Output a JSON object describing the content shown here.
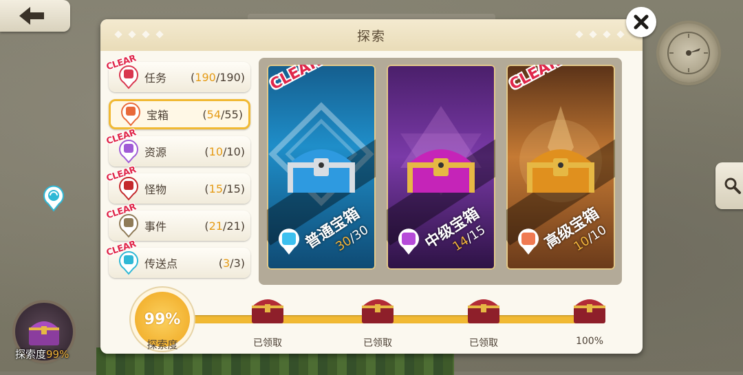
{
  "panel": {
    "title": "探索"
  },
  "categories": [
    {
      "label": "任务",
      "done": "190",
      "total": "190",
      "clear": "CLEAR",
      "color": "#d9364f"
    },
    {
      "label": "宝箱",
      "done": "54",
      "total": "55",
      "clear": "",
      "color": "#e8693a"
    },
    {
      "label": "资源",
      "done": "10",
      "total": "10",
      "clear": "CLEAR",
      "color": "#a05bd6"
    },
    {
      "label": "怪物",
      "done": "15",
      "total": "15",
      "clear": "CLEAR",
      "color": "#c4282c"
    },
    {
      "label": "事件",
      "done": "21",
      "total": "21",
      "clear": "CLEAR",
      "color": "#8f7b58"
    },
    {
      "label": "传送点",
      "done": "3",
      "total": "3",
      "clear": "CLEAR",
      "color": "#2fb8d6"
    }
  ],
  "chests": [
    {
      "name": "普通宝箱",
      "done": "30",
      "total": "/30",
      "clear": "CLEAR",
      "body": "#2e9ae0",
      "trim": "#d8dde3",
      "badge": "#3cc0ef"
    },
    {
      "name": "中级宝箱",
      "done": "14",
      "total": "/15",
      "clear": "",
      "body": "#c524b8",
      "trim": "#e6b844",
      "badge": "#b64bd9"
    },
    {
      "name": "高级宝箱",
      "done": "10",
      "total": "/10",
      "clear": "CLEAR",
      "body": "#e0901e",
      "trim": "#e6b844",
      "badge": "#f07a52"
    }
  ],
  "progress": {
    "percent_text": "99%",
    "percent_value": 0.99,
    "label": "探索度",
    "rewards": [
      {
        "label": "已领取"
      },
      {
        "label": "已领取"
      },
      {
        "label": "已领取"
      },
      {
        "label": "100%"
      }
    ]
  },
  "explore_badge": {
    "label": "探索度",
    "percent": "99%"
  },
  "icons": {
    "back": "back-arrow-icon",
    "close": "close-icon",
    "search": "search-icon",
    "compass": "compass-icon",
    "chest": "treasure-chest-icon"
  }
}
